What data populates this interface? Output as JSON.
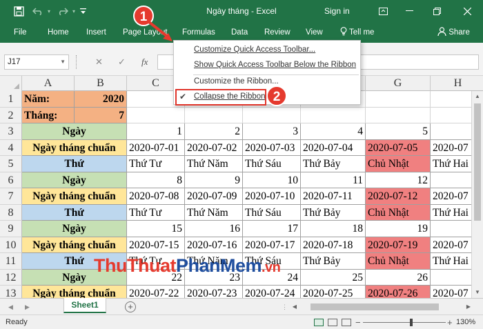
{
  "window": {
    "title": "Ngày tháng  -  Excel",
    "signin": "Sign in",
    "accent": "#217346"
  },
  "tabs": {
    "file": "File",
    "home": "Home",
    "insert": "Insert",
    "page_layout": "Page Layout",
    "formulas": "Formulas",
    "data": "Data",
    "review": "Review",
    "view": "View",
    "tell_me": "Tell me",
    "share": "Share"
  },
  "formula_bar": {
    "name_box": "J17",
    "fx": "fx",
    "cancel": "✕",
    "enter": "✓",
    "formula": ""
  },
  "menu": {
    "items": [
      "Customize Quick Access Toolbar...",
      "Show Quick Access Toolbar Below the Ribbon",
      "Customize the Ribbon...",
      "Collapse the Ribbon"
    ],
    "checked_item": "Collapse the Ribbon",
    "highlight_color": "#e0342a"
  },
  "grid": {
    "columns": [
      "A",
      "B",
      "C",
      "D",
      "E",
      "F",
      "G",
      "H"
    ],
    "selected_column": "",
    "rows": [
      {
        "num": "1",
        "a": "Năm:",
        "b": "2020",
        "cells": [
          "",
          "",
          "",
          "",
          "",
          ""
        ]
      },
      {
        "num": "2",
        "a": "Tháng:",
        "b": "7",
        "cells": [
          "",
          "",
          "",
          "",
          "",
          ""
        ]
      },
      {
        "num": "3",
        "label": "Ngày",
        "cells": [
          "1",
          "2",
          "3",
          "4",
          "5",
          ""
        ]
      },
      {
        "num": "4",
        "label": "Ngày tháng chuẩn",
        "cells": [
          "2020-07-01",
          "2020-07-02",
          "2020-07-03",
          "2020-07-04",
          "2020-07-05",
          "2020-07"
        ]
      },
      {
        "num": "5",
        "label": "Thứ",
        "cells": [
          "Thứ Tư",
          "Thứ Năm",
          "Thứ Sáu",
          "Thứ Bảy",
          "Chủ Nhật",
          "Thứ Hai"
        ]
      },
      {
        "num": "6",
        "label": "Ngày",
        "cells": [
          "8",
          "9",
          "10",
          "11",
          "12",
          ""
        ]
      },
      {
        "num": "7",
        "label": "Ngày tháng chuẩn",
        "cells": [
          "2020-07-08",
          "2020-07-09",
          "2020-07-10",
          "2020-07-11",
          "2020-07-12",
          "2020-07"
        ]
      },
      {
        "num": "8",
        "label": "Thứ",
        "cells": [
          "Thứ Tư",
          "Thứ Năm",
          "Thứ Sáu",
          "Thứ Bảy",
          "Chủ Nhật",
          "Thứ Hai"
        ]
      },
      {
        "num": "9",
        "label": "Ngày",
        "cells": [
          "15",
          "16",
          "17",
          "18",
          "19",
          ""
        ]
      },
      {
        "num": "10",
        "label": "Ngày tháng chuẩn",
        "cells": [
          "2020-07-15",
          "2020-07-16",
          "2020-07-17",
          "2020-07-18",
          "2020-07-19",
          "2020-07"
        ]
      },
      {
        "num": "11",
        "label": "Thứ",
        "cells": [
          "Thứ Tư",
          "Thứ Năm",
          "Thứ Sáu",
          "Thứ Bảy",
          "Chủ Nhật",
          "Thứ Hai"
        ]
      },
      {
        "num": "12",
        "label": "Ngày",
        "cells": [
          "22",
          "23",
          "24",
          "25",
          "26",
          ""
        ]
      },
      {
        "num": "13",
        "label": "Ngày tháng chuẩn",
        "cells": [
          "2020-07-22",
          "2020-07-23",
          "2020-07-24",
          "2020-07-25",
          "2020-07-26",
          "2020-07"
        ]
      }
    ],
    "colors": {
      "year_month": "#f4b183",
      "ngay": "#c6e0b4",
      "ngay_thang_chuan": "#ffe699",
      "thu": "#bdd7ee",
      "sunday": "#f08080"
    }
  },
  "sheets": {
    "active": "Sheet1"
  },
  "status": {
    "ready": "Ready",
    "zoom": "130%"
  },
  "callouts": [
    "1",
    "2"
  ],
  "watermark": {
    "part1": "ThuThuat",
    "part2": "PhanMem",
    "part3": ".vn"
  }
}
